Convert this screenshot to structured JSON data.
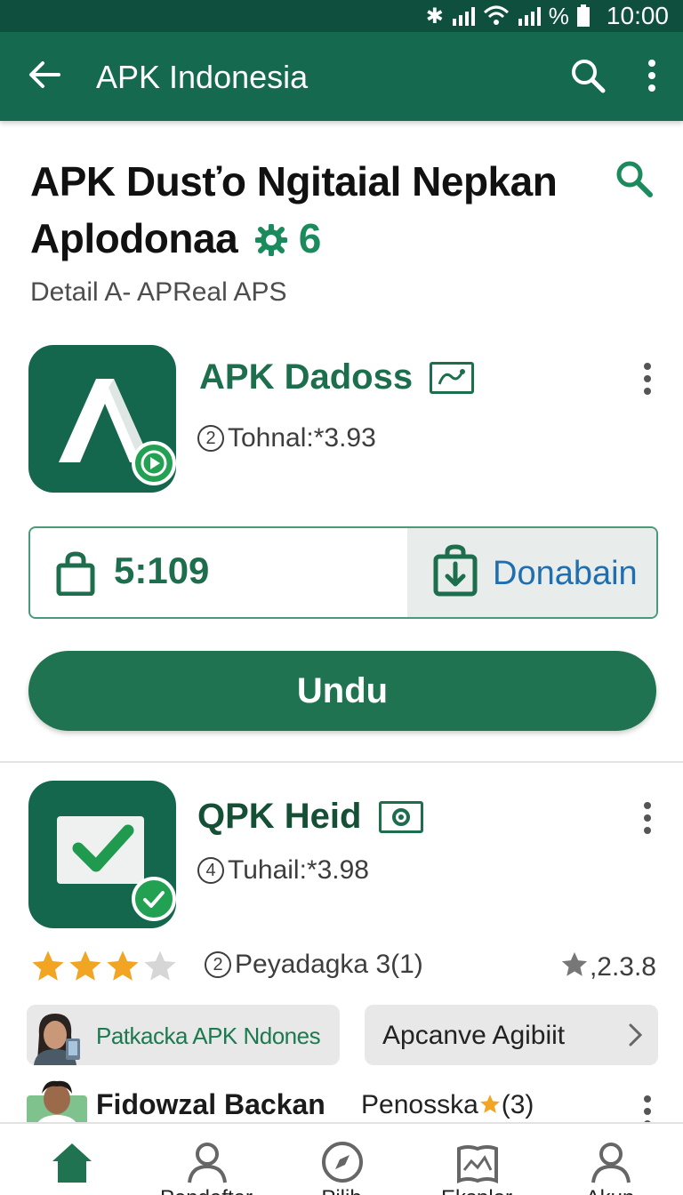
{
  "status_bar": {
    "battery_text": "%",
    "time": "10:00"
  },
  "app_bar": {
    "title": "APK Indonesia"
  },
  "page": {
    "title_line1": "APK Dusťo Ngitaial Nepkan",
    "title_line2": "Aplodonaa",
    "title_badge": "6",
    "subtitle": "Detail A- APReal APS"
  },
  "app1": {
    "name": "APK Dadoss",
    "meta_num": "2",
    "meta": "Tohnal:*3.93"
  },
  "split_card": {
    "left_value": "5:109",
    "right_label": "Donabain"
  },
  "primary_button": "Undu",
  "app2": {
    "name": "QPK Heid",
    "meta_num": "4",
    "meta": "Tuhail:*3.98"
  },
  "rating": {
    "stars_filled": 3,
    "stars_total": 4,
    "num": "2",
    "text": "Peyadagka 3(1)",
    "right": ",2.3.8"
  },
  "chip_left": {
    "label": "Patkacka APK Ndones"
  },
  "chip_right": {
    "label": "Apcanve Agibiit"
  },
  "user_row": {
    "name": "Fidowzal Backan",
    "role_prefix": "Penosska",
    "role_suffix": "(3)"
  },
  "colors": {
    "primary": "#15694f",
    "status_bar": "#0f4f3d",
    "accent_green": "#22a152",
    "link_blue": "#1f6fb0",
    "star": "#f2a423"
  },
  "icons": [
    "back-arrow-icon",
    "search-icon",
    "more-vert-icon",
    "gear-icon",
    "shopping-bag-icon",
    "download-bag-icon",
    "star-icon",
    "chevron-right-icon",
    "home-icon",
    "person-icon",
    "compass-icon",
    "book-icon",
    "account-icon"
  ],
  "bottom_nav": [
    {
      "label": ""
    },
    {
      "label": "Pendaftar"
    },
    {
      "label": "Pilih"
    },
    {
      "label": "Eksplor"
    },
    {
      "label": "Akun"
    }
  ]
}
